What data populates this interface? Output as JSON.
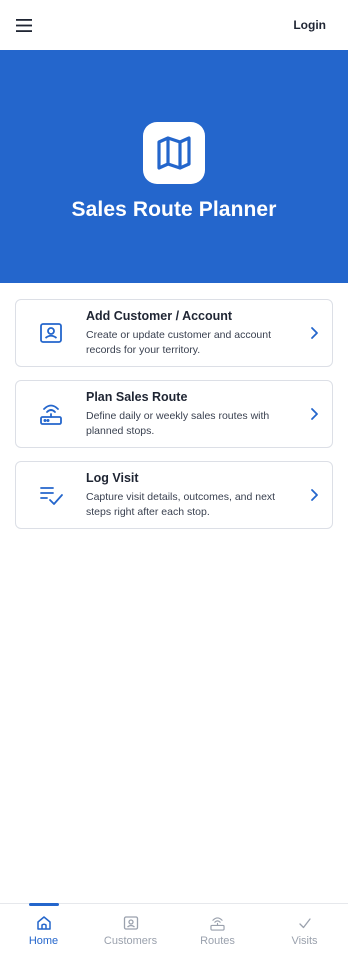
{
  "header": {
    "menu_icon": "hamburger-menu-icon",
    "login_label": "Login"
  },
  "hero": {
    "logo_icon": "map-icon",
    "title": "Sales Route Planner",
    "background": "#2466cc"
  },
  "cards": [
    {
      "icon": "contact-card-icon",
      "title": "Add Customer / Account",
      "description": "Create or update customer and account records for your territory."
    },
    {
      "icon": "router-icon",
      "title": "Plan Sales Route",
      "description": "Define daily or weekly sales routes with planned stops."
    },
    {
      "icon": "checklist-icon",
      "title": "Log Visit",
      "description": "Capture visit details, outcomes, and next steps right after each stop."
    }
  ],
  "bottom_nav": {
    "active": "Home",
    "items": [
      {
        "label": "Home",
        "icon": "home-icon"
      },
      {
        "label": "Customers",
        "icon": "contact-card-icon"
      },
      {
        "label": "Routes",
        "icon": "router-icon"
      },
      {
        "label": "Visits",
        "icon": "check-icon"
      }
    ]
  },
  "colors": {
    "accent": "#2466cc",
    "text": "#1f2533",
    "muted": "#9aa1ad",
    "border": "#dcdfe6"
  }
}
